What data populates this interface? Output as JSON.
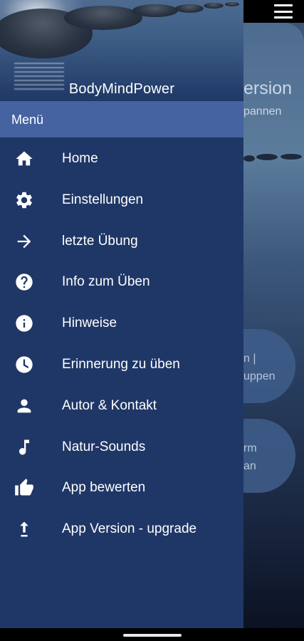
{
  "app": {
    "name": "BodyMindPower"
  },
  "drawer": {
    "section_title": "Menü",
    "items": [
      {
        "label": "Home",
        "icon": "home-icon"
      },
      {
        "label": "Einstellungen",
        "icon": "gear-icon"
      },
      {
        "label": "letzte Übung",
        "icon": "arrow-right-icon"
      },
      {
        "label": "Info zum Üben",
        "icon": "help-circle-icon"
      },
      {
        "label": "Hinweise",
        "icon": "info-circle-icon"
      },
      {
        "label": "Erinnerung zu üben",
        "icon": "clock-icon"
      },
      {
        "label": "Autor & Kontakt",
        "icon": "person-icon"
      },
      {
        "label": "Natur-Sounds",
        "icon": "music-note-icon"
      },
      {
        "label": "App bewerten",
        "icon": "thumbs-up-icon"
      },
      {
        "label": "App Version - upgrade",
        "icon": "upload-icon"
      }
    ]
  },
  "background": {
    "title_fragment": "ersion",
    "subtitle_fragment": "pannen",
    "pill1": {
      "line1": "n |",
      "line2": "uppen"
    },
    "pill2": {
      "line1": "rm",
      "line2": "an"
    }
  },
  "colors": {
    "drawer_bg": "#1f3766",
    "menu_bar_bg": "#4563a0",
    "text": "#ffffff"
  }
}
